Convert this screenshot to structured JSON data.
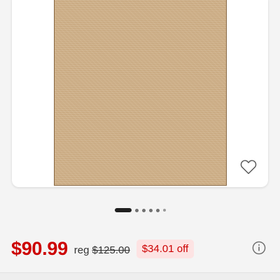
{
  "product_image": {
    "alt": "",
    "icon": "heart-icon"
  },
  "carousel": {
    "total_dots": 6,
    "active_index": 0
  },
  "pricing": {
    "sale_price": "$90.99",
    "reg_label": "reg",
    "reg_price": "$125.00",
    "savings": "$34.01 off",
    "info_icon": "info-icon",
    "sale_color": "#cc0000",
    "badge_bg": "#fde3e3"
  }
}
